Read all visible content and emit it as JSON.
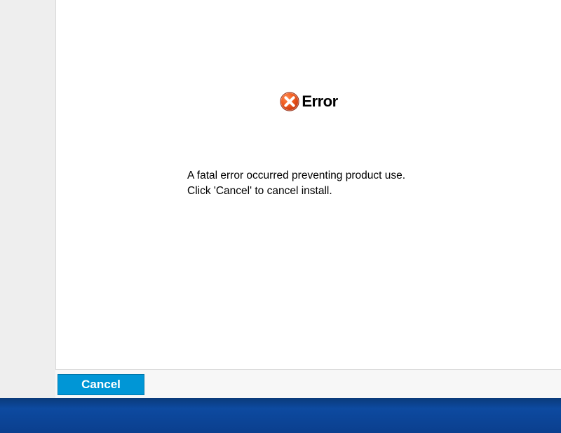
{
  "dialog": {
    "title": "Error",
    "icon": "error-x-icon",
    "message_line1": "A fatal error occurred preventing product use.",
    "message_line2": "Click 'Cancel' to cancel install.",
    "cancel_label": "Cancel"
  },
  "colors": {
    "accent": "#0096d6",
    "error_icon": "#e84c1a"
  }
}
